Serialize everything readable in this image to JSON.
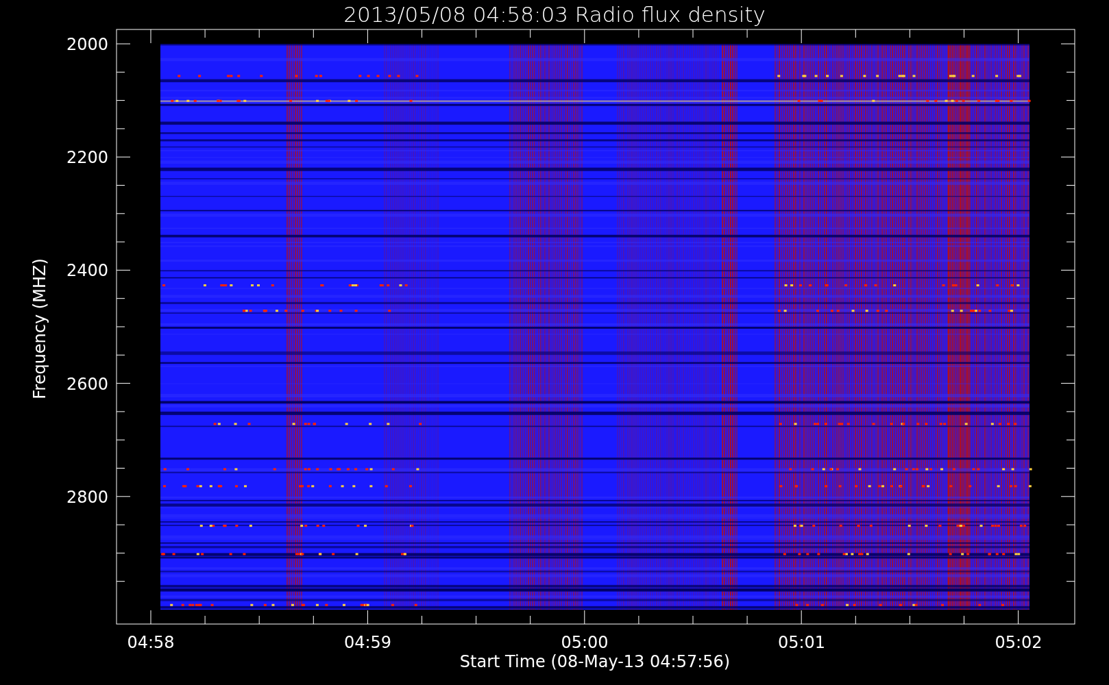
{
  "title": "2013/05/08 04:58:03 Radio flux density",
  "plot": {
    "ylabel": "Frequency (MHZ)",
    "xlabel": "Start Time (08-May-13 04:57:56)",
    "yticks": [
      "2000",
      "2200",
      "2400",
      "2600",
      "2800"
    ],
    "xticks": [
      "04:58",
      "04:59",
      "05:00",
      "05:01",
      "05:02"
    ]
  }
}
